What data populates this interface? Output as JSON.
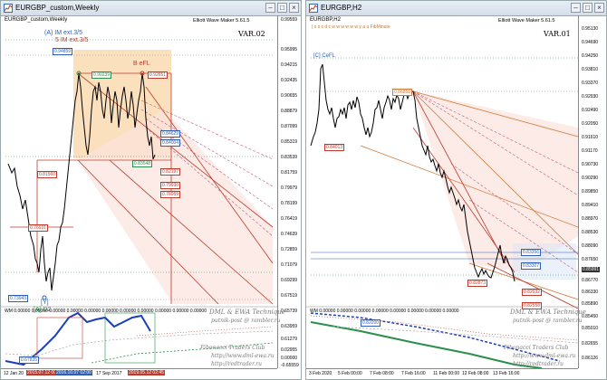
{
  "left": {
    "title": "EURGBP_custom,Weekly",
    "symbol": "EURGBP_custom,Weekly",
    "ewm": "Elliott Wave Maker 5.61.5",
    "var": "VAR.02",
    "wave_labels": {
      "top1": "(A) IM ext.3/5",
      "top2": "5 IM ext.3/5",
      "bfl": "B eFL",
      "a_d2": "[A] D2",
      "y": "[Y]"
    },
    "price_axis": [
      "0.99559",
      "0.95995",
      "0.94215",
      "0.92435",
      "0.90655",
      "0.88879",
      "0.87099",
      "0.85319",
      "0.83539",
      "0.81759",
      "0.79979",
      "0.78199",
      "0.76419",
      "0.74639",
      "0.72859",
      "0.71079",
      "0.69299",
      "0.67519",
      "0.65739",
      "0.63959",
      "0.61279",
      "0.02955",
      "0.00000",
      "-0.65559"
    ],
    "boxes": [
      "0.94859",
      "0.92651",
      "0.90239",
      "0.84629",
      "0.84004",
      "0.83548",
      "0.82197",
      "0.81560",
      "0.79930",
      "0.78959",
      "0.76931",
      "0.73943",
      "0.67835"
    ],
    "time_axis": [
      "12 Jan 20",
      "2015.07.12 00:00",
      "2016.10.07 02:00",
      "17 Sep 2017",
      "2019.05.12 02:45"
    ],
    "watermark": {
      "l1": "DML & EWA Technique",
      "l2": "putnik-post @ rambler.ru",
      "l3": "Fibonacci   Traders   Club",
      "l4": "http://www.dml-ewa.ru",
      "l5": "http://redtrader.ru"
    },
    "wm_indicator": "WM 0.00000 0.00000 0.00000 0.00000 0.00000 0.00000 0.00000 0.00000 0.00000 0.00000 0.00000"
  },
  "right": {
    "title": "EURGBP,H2",
    "symbol": "EURGBP,H2",
    "ewm": "Elliott Wave Maker 5.61.5",
    "var": "VAR.01",
    "fibo_days": "|  s  s  s  d  c  w  w  w  w  w  w  y  a  u   FibMinute",
    "wave_labels": {
      "cfl": "[C] CeFL"
    },
    "price_axis": [
      "0.95130",
      "0.94690",
      "0.94250",
      "0.93810",
      "0.93370",
      "0.92930",
      "0.92490",
      "0.92050",
      "0.91610",
      "0.91170",
      "0.90730",
      "0.90290",
      "0.89850",
      "0.89410",
      "0.88970",
      "0.88530",
      "0.88090",
      "0.87650",
      "0.85991",
      "0.86770",
      "0.86330",
      "0.85890",
      "0.85450",
      "0.85010",
      "0.82655",
      "0.86126"
    ],
    "boxes": [
      "0.86858",
      "0.84013",
      "0.83356",
      "0.83307",
      "0.82932",
      "0.82873",
      "0.82558",
      "0.82200"
    ],
    "time_axis": [
      "3 Feb 2020",
      "5 Feb 00:00",
      "7 Feb 08:00",
      "7 Feb 16:00",
      "11 Feb 00:00",
      "12 Feb 08:00",
      "13 Feb 16:00"
    ],
    "watermark": {
      "l1": "DML & EWA Technique",
      "l2": "putnik-post @ rambler.ru",
      "l3": "Fibonacci   Traders   Club",
      "l4": "http://www.dml-ewa.ru",
      "l5": "http://redtrader.ru"
    },
    "wm_indicator": "WM 0.00000 0.00000 0.00000 0.00000 0.00000 0.00000 0.00000 0.00000"
  }
}
